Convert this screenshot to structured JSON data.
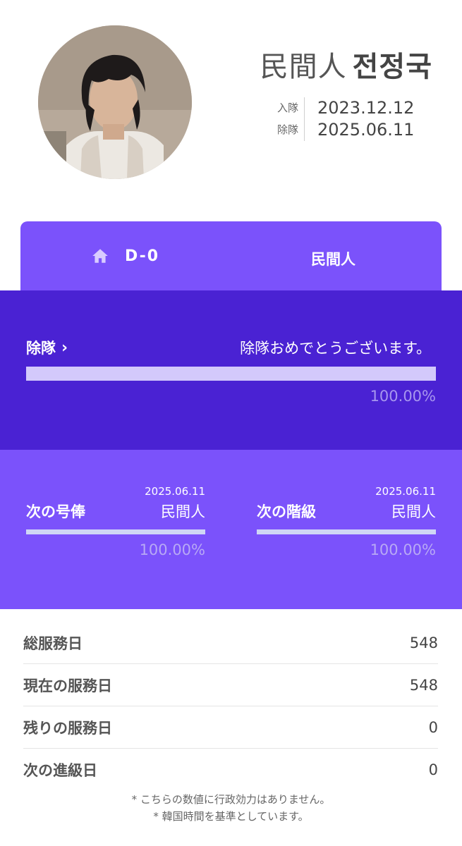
{
  "profile": {
    "avatar_alt": "profile photo",
    "name_prefix": "民間人",
    "name_main": "전정국",
    "enlist_label": "入隊",
    "enlist_date": "2023.12.12",
    "discharge_label": "除隊",
    "discharge_date": "2025.06.11"
  },
  "tabs": {
    "home_icon": "home-icon",
    "dday": "D-0",
    "status": "民間人"
  },
  "discharge": {
    "title": "除隊",
    "chevron": "›",
    "message": "除隊おめでとうございます。",
    "progress": 1.0,
    "percent_text": "100.00%"
  },
  "ranks": [
    {
      "label": "次の号俸",
      "date": "2025.06.11",
      "value": "民間人",
      "progress": 1.0,
      "percent_text": "100.00%"
    },
    {
      "label": "次の階級",
      "date": "2025.06.11",
      "value": "民間人",
      "progress": 1.0,
      "percent_text": "100.00%"
    }
  ],
  "stats": [
    {
      "label": "総服務日",
      "value": "548"
    },
    {
      "label": "現在の服務日",
      "value": "548"
    },
    {
      "label": "残りの服務日",
      "value": "0"
    },
    {
      "label": "次の進級日",
      "value": "0"
    }
  ],
  "notes": {
    "line1": "* こちらの数値に行政効力はありません。",
    "line2": "* 韓国時間を基準としています。"
  },
  "colors": {
    "tab_bg": "#7b52fb",
    "dark_bg": "#4a22d3",
    "bar_fill": "#d3c9fb"
  }
}
